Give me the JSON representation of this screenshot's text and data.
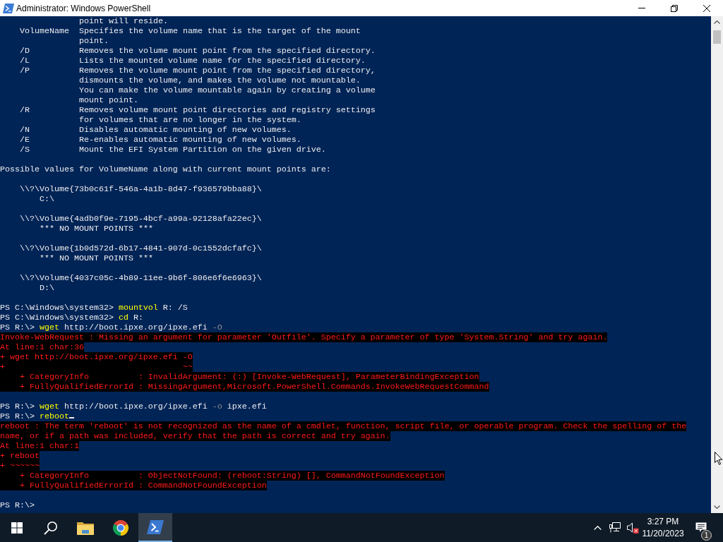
{
  "window": {
    "title": "Administrator: Windows PowerShell"
  },
  "console": {
    "lines": [
      {
        "kind": "continuation",
        "text": "point will reside."
      },
      {
        "kind": "option",
        "option": "VolumeName",
        "description": "Specifies the volume name that is the target of the mount"
      },
      {
        "kind": "continuation",
        "text": "point."
      },
      {
        "kind": "option",
        "option": "/D",
        "description": "Removes the volume mount point from the specified directory."
      },
      {
        "kind": "option",
        "option": "/L",
        "description": "Lists the mounted volume name for the specified directory."
      },
      {
        "kind": "option",
        "option": "/P",
        "description": "Removes the volume mount point from the specified directory,"
      },
      {
        "kind": "continuation",
        "text": "dismounts the volume, and makes the volume not mountable."
      },
      {
        "kind": "continuation",
        "text": "You can make the volume mountable again by creating a volume"
      },
      {
        "kind": "continuation",
        "text": "mount point."
      },
      {
        "kind": "option",
        "option": "/R",
        "description": "Removes volume mount point directories and registry settings"
      },
      {
        "kind": "continuation",
        "text": "for volumes that are no longer in the system."
      },
      {
        "kind": "option",
        "option": "/N",
        "description": "Disables automatic mounting of new volumes."
      },
      {
        "kind": "option",
        "option": "/E",
        "description": "Re-enables automatic mounting of new volumes."
      },
      {
        "kind": "option",
        "option": "/S",
        "description": "Mount the EFI System Partition on the given drive."
      },
      {
        "kind": "blank"
      },
      {
        "kind": "text",
        "text": "Possible values for VolumeName along with current mount points are:"
      },
      {
        "kind": "blank"
      },
      {
        "kind": "volume",
        "text": "\\\\?\\Volume{73b0c61f-546a-4a1b-8d47-f936579bba88}\\"
      },
      {
        "kind": "mount_point",
        "text": "C:\\"
      },
      {
        "kind": "blank"
      },
      {
        "kind": "volume",
        "text": "\\\\?\\Volume{4adb0f9e-7195-4bcf-a99a-92128afa22ec}\\"
      },
      {
        "kind": "mount_point",
        "text": "*** NO MOUNT POINTS ***"
      },
      {
        "kind": "blank"
      },
      {
        "kind": "volume",
        "text": "\\\\?\\Volume{1b0d572d-6b17-4841-907d-0c1552dcfafc}\\"
      },
      {
        "kind": "mount_point",
        "text": "*** NO MOUNT POINTS ***"
      },
      {
        "kind": "blank"
      },
      {
        "kind": "volume",
        "text": "\\\\?\\Volume{4037c05c-4b89-11ee-9b6f-806e6f6e6963}\\"
      },
      {
        "kind": "mount_point",
        "text": "D:\\"
      },
      {
        "kind": "blank"
      },
      {
        "kind": "prompt",
        "prompt": "PS C:\\Windows\\system32>",
        "tokens": [
          {
            "kind": "command",
            "text": "mountvol"
          },
          {
            "kind": "argument",
            "text": "R:"
          },
          {
            "kind": "argument",
            "text": "/S"
          }
        ],
        "cursor": false
      },
      {
        "kind": "prompt",
        "prompt": "PS C:\\Windows\\system32>",
        "tokens": [
          {
            "kind": "command",
            "text": "cd"
          },
          {
            "kind": "argument",
            "text": "R:"
          }
        ],
        "cursor": false
      },
      {
        "kind": "prompt",
        "prompt": "PS R:\\>",
        "tokens": [
          {
            "kind": "command",
            "text": "wget"
          },
          {
            "kind": "argument",
            "text": "http://boot.ipxe.org/ipxe.efi"
          },
          {
            "kind": "parameter",
            "text": "-O"
          }
        ],
        "cursor": false
      },
      {
        "kind": "error",
        "text": "Invoke-WebRequest : Missing an argument for parameter 'Outfile'. Specify a parameter of type 'System.String' and try again."
      },
      {
        "kind": "error",
        "text": "At line:1 char:36"
      },
      {
        "kind": "error",
        "text": "+ wget http://boot.ipxe.org/ipxe.efi -O"
      },
      {
        "kind": "error",
        "text": "+                                    ~~"
      },
      {
        "kind": "error_detail",
        "text": "+ CategoryInfo          : InvalidArgument: (:) [Invoke-WebRequest], ParameterBindingException"
      },
      {
        "kind": "error_detail",
        "text": "+ FullyQualifiedErrorId : MissingArgument,Microsoft.PowerShell.Commands.InvokeWebRequestCommand"
      },
      {
        "kind": "blank"
      },
      {
        "kind": "prompt",
        "prompt": "PS R:\\>",
        "tokens": [
          {
            "kind": "command",
            "text": "wget"
          },
          {
            "kind": "argument",
            "text": "http://boot.ipxe.org/ipxe.efi"
          },
          {
            "kind": "parameter",
            "text": "-o"
          },
          {
            "kind": "argument",
            "text": "ipxe.efi"
          }
        ],
        "cursor": false
      },
      {
        "kind": "prompt",
        "prompt": "PS R:\\>",
        "tokens": [
          {
            "kind": "command",
            "text": "reboot"
          }
        ],
        "cursor": true
      },
      {
        "kind": "error",
        "text": "reboot : The term 'reboot' is not recognized as the name of a cmdlet, function, script file, or operable program. Check the spelling of the"
      },
      {
        "kind": "error",
        "text": "name, or if a path was included, verify that the path is correct and try again."
      },
      {
        "kind": "error",
        "text": "At line:1 char:1"
      },
      {
        "kind": "error",
        "text": "+ reboot"
      },
      {
        "kind": "error",
        "text": "+ ~~~~~~"
      },
      {
        "kind": "error_detail",
        "text": "+ CategoryInfo          : ObjectNotFound: (reboot:String) [], CommandNotFoundException"
      },
      {
        "kind": "error_detail",
        "text": "+ FullyQualifiedErrorId : CommandNotFoundException"
      },
      {
        "kind": "blank"
      },
      {
        "kind": "prompt",
        "prompt": "PS R:\\>",
        "cursor": false
      }
    ]
  },
  "taskbar": {
    "pinned": [
      {
        "kind": "folder",
        "selected": false
      },
      {
        "kind": "browser",
        "selected": false
      },
      {
        "kind": "terminal",
        "selected": true
      }
    ],
    "tray": {
      "volume_muted": true,
      "clock": {
        "time": "3:27 PM",
        "date": "11/20/2023"
      },
      "notification_count": "1"
    }
  }
}
